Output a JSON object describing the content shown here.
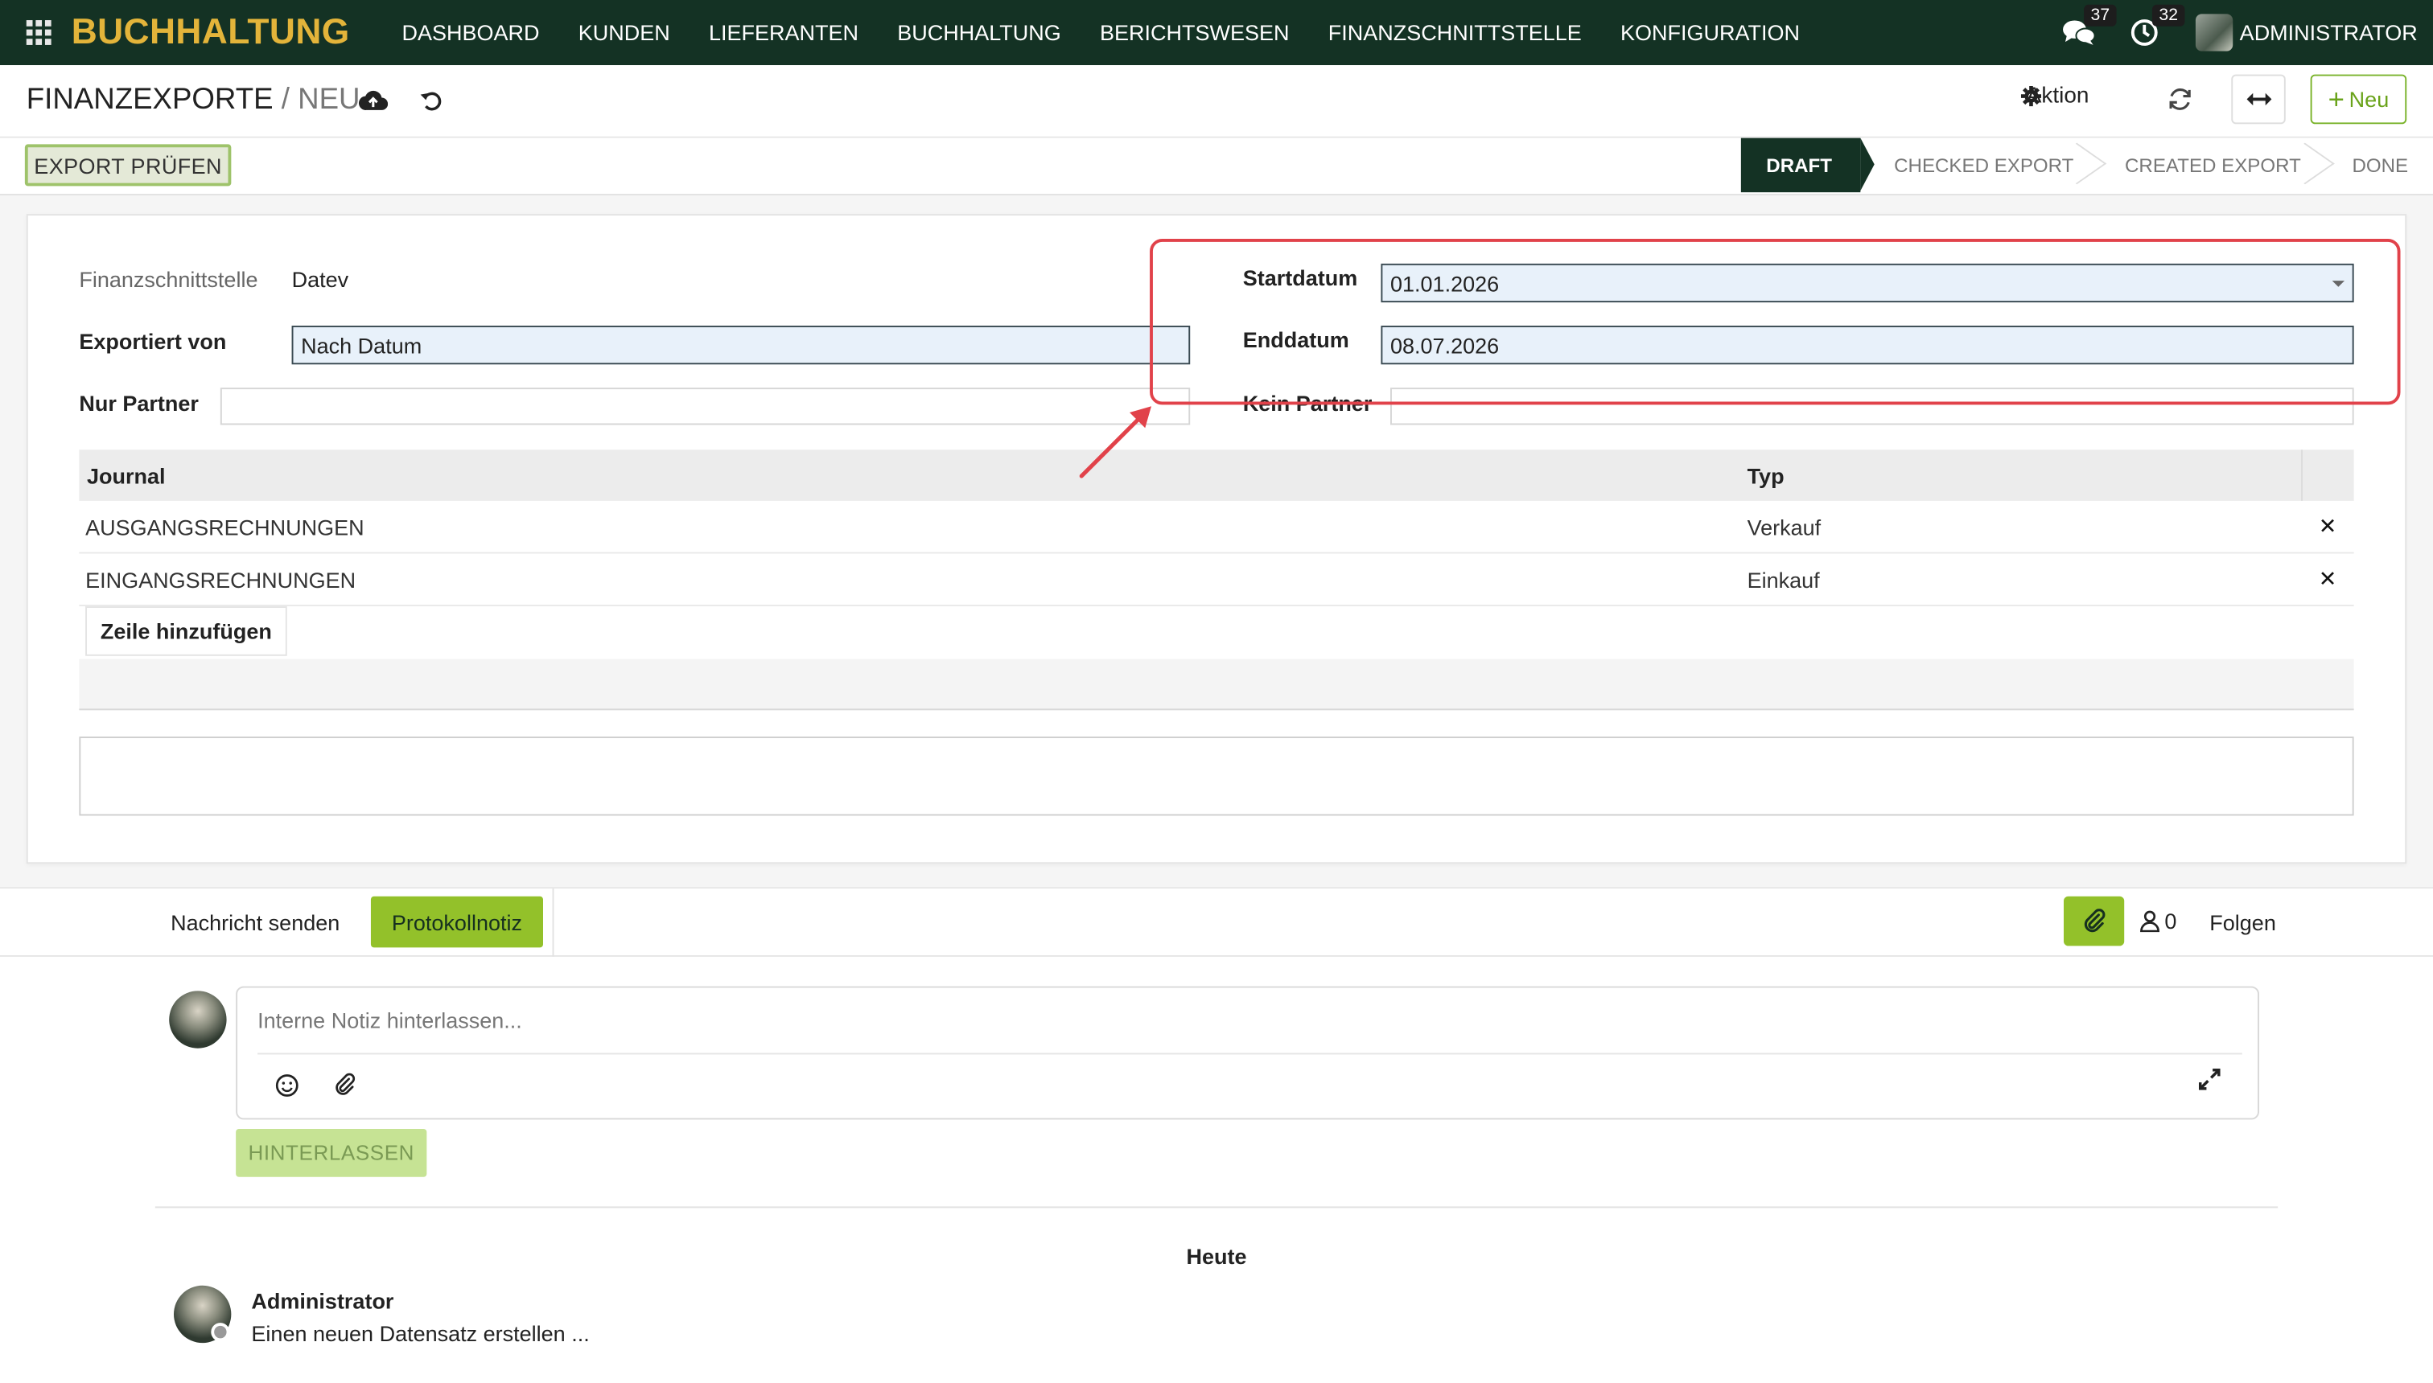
{
  "navbar": {
    "brand": "BUCHHALTUNG",
    "menu": [
      "DASHBOARD",
      "KUNDEN",
      "LIEFERANTEN",
      "BUCHHALTUNG",
      "BERICHTSWESEN",
      "FINANZSCHNITTSTELLE",
      "KONFIGURATION"
    ],
    "messages_count": "37",
    "activities_count": "32",
    "user": "ADMINISTRATOR"
  },
  "control_panel": {
    "breadcrumb_parent": "FINANZEXPORTE",
    "breadcrumb_sep": "/",
    "breadcrumb_current": "NEU",
    "action_label": "Aktion",
    "new_label": "Neu"
  },
  "statusbar": {
    "export_check_label": "EXPORT PRÜFEN",
    "steps": [
      "DRAFT",
      "CHECKED EXPORT",
      "CREATED EXPORT",
      "DONE"
    ],
    "active_step": "DRAFT"
  },
  "form": {
    "interface_label": "Finanzschnittstelle",
    "interface_value": "Datev",
    "exported_by_label": "Exportiert von",
    "exported_by_value": "Nach Datum",
    "only_partner_label": "Nur Partner",
    "only_partner_value": "",
    "start_label": "Startdatum",
    "start_value": "01.01.2026",
    "end_label": "Enddatum",
    "end_value": "08.07.2026",
    "no_partner_label": "Kein Partner",
    "no_partner_value": ""
  },
  "journal_table": {
    "headers": [
      "Journal",
      "Typ"
    ],
    "rows": [
      {
        "journal": "AUSGANGSRECHNUNGEN",
        "type": "Verkauf"
      },
      {
        "journal": "EINGANGSRECHNUNGEN",
        "type": "Einkauf"
      }
    ],
    "add_line_label": "Zeile hinzufügen"
  },
  "chatter": {
    "send_message": "Nachricht senden",
    "log_note": "Protokollnotiz",
    "followers_count": "0",
    "follow": "Folgen",
    "composer_placeholder": "Interne Notiz hinterlassen...",
    "submit_label": "HINTERLASSEN",
    "date_separator": "Heute",
    "messages": [
      {
        "author": "Administrator",
        "body": "Einen neuen Datensatz erstellen ..."
      }
    ]
  },
  "colors": {
    "navbar": "#143224",
    "brand": "#e3b43a",
    "accent_green": "#93c12a",
    "annotation_red": "#e1424a"
  }
}
